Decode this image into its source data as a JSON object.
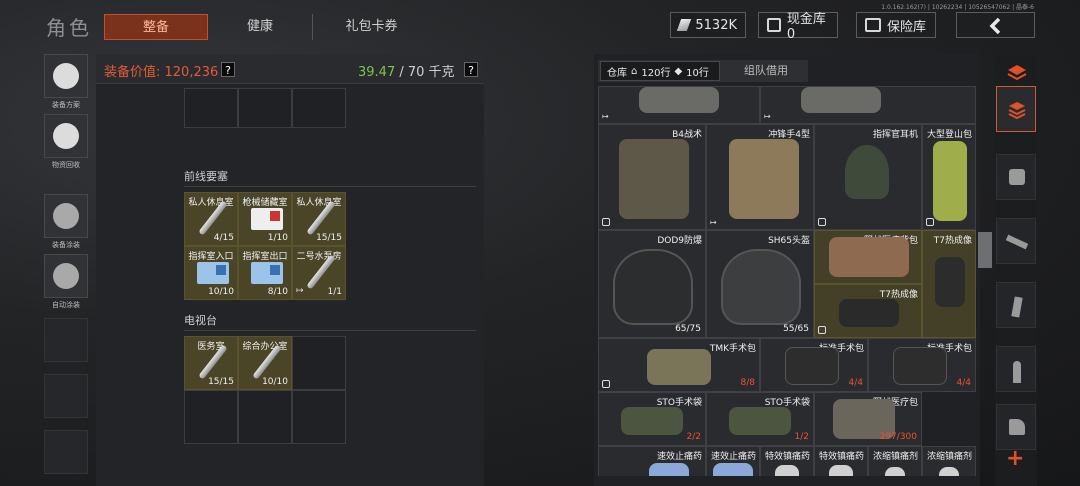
{
  "header": {
    "title": "角色",
    "tabs": [
      {
        "label": "整备",
        "active": true
      },
      {
        "label": "健康",
        "active": false
      },
      {
        "label": "礼包卡券",
        "active": false
      }
    ],
    "version": "1.0.162.162(7) | 10262234 | 10526547062 | 晶泰-6",
    "currency": "5132K",
    "cash_storage": "现金库 0",
    "safe_box": "保险库",
    "back_icon": "chevron-left-icon"
  },
  "left_sidebar": {
    "items": [
      {
        "label": "装备方案",
        "icon": "loadout-icon"
      },
      {
        "label": "物资回收",
        "icon": "recycle-icon"
      },
      {
        "label": "装备涂装",
        "icon": "paint-icon"
      },
      {
        "label": "自动涂装",
        "icon": "auto-paint-icon"
      }
    ]
  },
  "equipment": {
    "value_label": "装备价值: 120,236",
    "weight_current": "39.47",
    "weight_max": "/ 70 千克",
    "help": "?",
    "sections": [
      {
        "title": "前线要塞",
        "items": [
          {
            "name": "私人休息室",
            "count": "4/15",
            "kind": "key"
          },
          {
            "name": "枪械储藏室",
            "count": "1/10",
            "kind": "card-red"
          },
          {
            "name": "私人休息室",
            "count": "15/15",
            "kind": "key"
          },
          {
            "name": "指挥室入口",
            "count": "10/10",
            "kind": "card-blue"
          },
          {
            "name": "指挥室出口",
            "count": "8/10",
            "kind": "card-blue"
          },
          {
            "name": "二号水泵房",
            "count": "1/1",
            "kind": "key"
          }
        ]
      },
      {
        "title": "电视台",
        "items": [
          {
            "name": "医务室",
            "count": "15/15",
            "kind": "key"
          },
          {
            "name": "综合办公室",
            "count": "10/10",
            "kind": "key"
          }
        ]
      }
    ]
  },
  "storage": {
    "tab_label": "仓库",
    "rows": "120行",
    "rows2": "10行",
    "tab2_label": "组队借用",
    "items": [
      {
        "name": "B4战术",
        "count": "",
        "color": "#5e5848"
      },
      {
        "name": "冲锋手4型",
        "count": "",
        "color": "#8c7a5a"
      },
      {
        "name": "指挥官耳机",
        "count": "",
        "color": "#404a3a"
      },
      {
        "name": "大型登山包",
        "count": "",
        "color": "#9fae4a"
      },
      {
        "name": "DOD9防爆",
        "count": "65/75",
        "color": "#2b2d2e"
      },
      {
        "name": "SH65头盔",
        "count": "55/65",
        "color": "#3c3e40"
      },
      {
        "name": "野战医疗背包",
        "count": "",
        "color": "#8d6a50"
      },
      {
        "name": "T7热成像",
        "count": "",
        "color": "#2c2c2c"
      },
      {
        "name": "T7热成像",
        "count": "",
        "color": "#2a2a2a"
      },
      {
        "name": "TMK手术包",
        "count": "8/8",
        "color": "#7a7458"
      },
      {
        "name": "标准手术包",
        "count": "4/4",
        "color": "#2d2d2d"
      },
      {
        "name": "标准手术包",
        "count": "4/4",
        "color": "#2d2d2d"
      },
      {
        "name": "STO手术袋",
        "count": "2/2",
        "color": "#4c5540"
      },
      {
        "name": "STO手术袋",
        "count": "1/2",
        "color": "#4c5540"
      },
      {
        "name": "野战医疗包",
        "count": "297/300",
        "color": "#6b665c"
      },
      {
        "name": "速效止痛药",
        "count": "",
        "color": "#8aa8d8"
      },
      {
        "name": "速效止痛药",
        "count": "",
        "color": "#8aa8d8"
      },
      {
        "name": "特效镇痛药",
        "count": "",
        "color": "#d0d0d0"
      },
      {
        "name": "特效镇痛药",
        "count": "",
        "color": "#d0d0d0"
      },
      {
        "name": "浓缩镇痛剂",
        "count": "",
        "color": "#d0d0d0"
      },
      {
        "name": "浓缩镇痛剂",
        "count": "",
        "color": "#d0d0d0"
      }
    ]
  },
  "right_sidebar": {
    "icons": [
      "layers-icon",
      "stack-icon",
      "vest-icon",
      "rifle-icon",
      "magazine-icon",
      "ammo-icon",
      "tool-icon"
    ],
    "add": "+"
  },
  "colors": {
    "accent": "#c4502b",
    "value_red": "#e45a38",
    "weight_green": "#7ec64a"
  }
}
